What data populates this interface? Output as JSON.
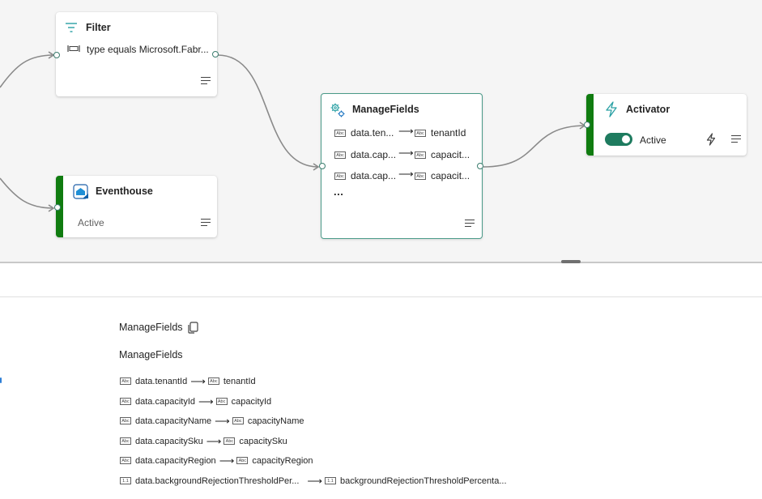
{
  "nodes": {
    "filter": {
      "title": "Filter",
      "condition": "type equals Microsoft.Fabr..."
    },
    "eventhouse": {
      "title": "Eventhouse",
      "status": "Active"
    },
    "managefields": {
      "title": "ManageFields",
      "mappings": [
        {
          "from": "data.ten...",
          "to": "tenantId"
        },
        {
          "from": "data.cap...",
          "to": "capacit..."
        },
        {
          "from": "data.cap...",
          "to": "capacit..."
        }
      ],
      "more": "..."
    },
    "activator": {
      "title": "Activator",
      "status": "Active",
      "toggle_on": true
    }
  },
  "panel": {
    "name": "ManageFields",
    "operation": "ManageFields",
    "mappings": [
      {
        "type": "Abc",
        "from": "data.tenantId",
        "to_type": "Abc",
        "to": "tenantId"
      },
      {
        "type": "Abc",
        "from": "data.capacityId",
        "to_type": "Abc",
        "to": "capacityId"
      },
      {
        "type": "Abc",
        "from": "data.capacityName",
        "to_type": "Abc",
        "to": "capacityName"
      },
      {
        "type": "Abc",
        "from": "data.capacitySku",
        "to_type": "Abc",
        "to": "capacitySku"
      },
      {
        "type": "Abc",
        "from": "data.capacityRegion",
        "to_type": "Abc",
        "to": "capacityRegion"
      },
      {
        "type": "1.1",
        "from": "data.backgroundRejectionThresholdPer...",
        "to_type": "1.1",
        "to": "backgroundRejectionThresholdPercenta..."
      }
    ]
  },
  "icons": {
    "filter": "filter-icon",
    "eventhouse": "eventhouse-icon",
    "managefields": "gear-icon",
    "activator": "lightning-icon",
    "copy": "copy-icon",
    "menu": "menu-lines-icon"
  },
  "colors": {
    "accent": "#1e7b5f",
    "status_bar": "#107c10",
    "selected_border": "#4a9a88",
    "filter_icon": "#2aa0a4"
  }
}
